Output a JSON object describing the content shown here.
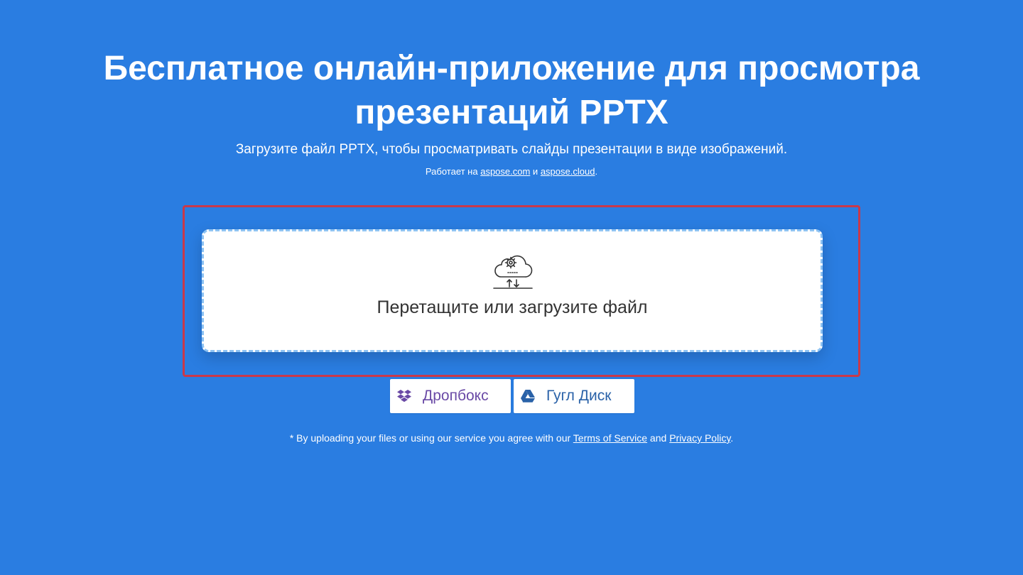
{
  "header": {
    "title_line1": "Бесплатное онлайн-приложение для просмотра",
    "title_line2": "презентаций PPTX",
    "subtitle": "Загрузите файл PPTX, чтобы просматривать слайды презентации в виде изображений.",
    "powered_prefix": "Работает на ",
    "powered_link1": "aspose.com",
    "powered_middle": " и ",
    "powered_link2": "aspose.cloud",
    "powered_suffix": "."
  },
  "upload": {
    "drop_label": "Перетащите или загрузите файл",
    "icon": "cloud-gear-icon"
  },
  "cloud_buttons": {
    "dropbox_label": "Дропбокс",
    "dropbox_icon": "dropbox-icon",
    "gdrive_label": "Гугл Диск",
    "gdrive_icon": "google-drive-icon"
  },
  "footer": {
    "terms_prefix": "* By uploading your files or using our service you agree with our ",
    "terms_link": "Terms of Service",
    "terms_middle": " and ",
    "privacy_link": "Privacy Policy",
    "terms_suffix": "."
  },
  "colors": {
    "background": "#2a7de1",
    "highlight": "#c9394a",
    "dropbox": "#6a4aa6",
    "gdrive": "#2a62a8"
  }
}
